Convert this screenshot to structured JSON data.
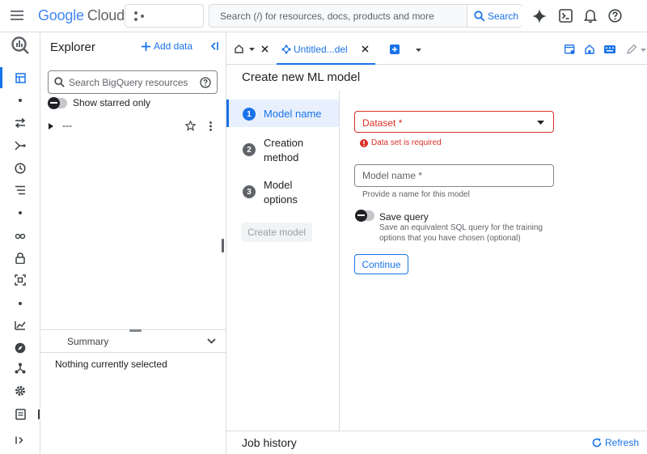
{
  "header": {
    "logo_word1": "Google",
    "logo_word2": "Cloud",
    "search_placeholder": "Search (/) for resources, docs, products and more",
    "search_button": "Search"
  },
  "explorer": {
    "title": "Explorer",
    "add_data": "Add data",
    "search_placeholder": "Search BigQuery resources",
    "show_starred": "Show starred only",
    "tree_item": "---",
    "summary_title": "Summary",
    "summary_empty": "Nothing currently selected"
  },
  "tabs": {
    "active_label": "Untitled...del"
  },
  "page": {
    "title": "Create new ML model",
    "steps": [
      {
        "number": "1",
        "label_line1": "Model name",
        "label_line2": ""
      },
      {
        "number": "2",
        "label_line1": "Creation",
        "label_line2": "method"
      },
      {
        "number": "3",
        "label_line1": "Model",
        "label_line2": "options"
      }
    ],
    "create_model": "Create model",
    "dataset_label": "Dataset *",
    "dataset_error": "Data set is required",
    "model_name_placeholder": "Model name *",
    "model_name_hint": "Provide a name for this model",
    "save_query_label": "Save query",
    "save_query_desc_line1": "Save an equivalent SQL query for the training",
    "save_query_desc_line2": "options that you have chosen (optional)",
    "continue": "Continue"
  },
  "job_history": {
    "title": "Job history",
    "refresh": "Refresh"
  },
  "colors": {
    "accent": "#1a73e8",
    "error": "#d93025",
    "step_inactive": "#5f6368",
    "selected_bg": "#e8f0fe"
  }
}
